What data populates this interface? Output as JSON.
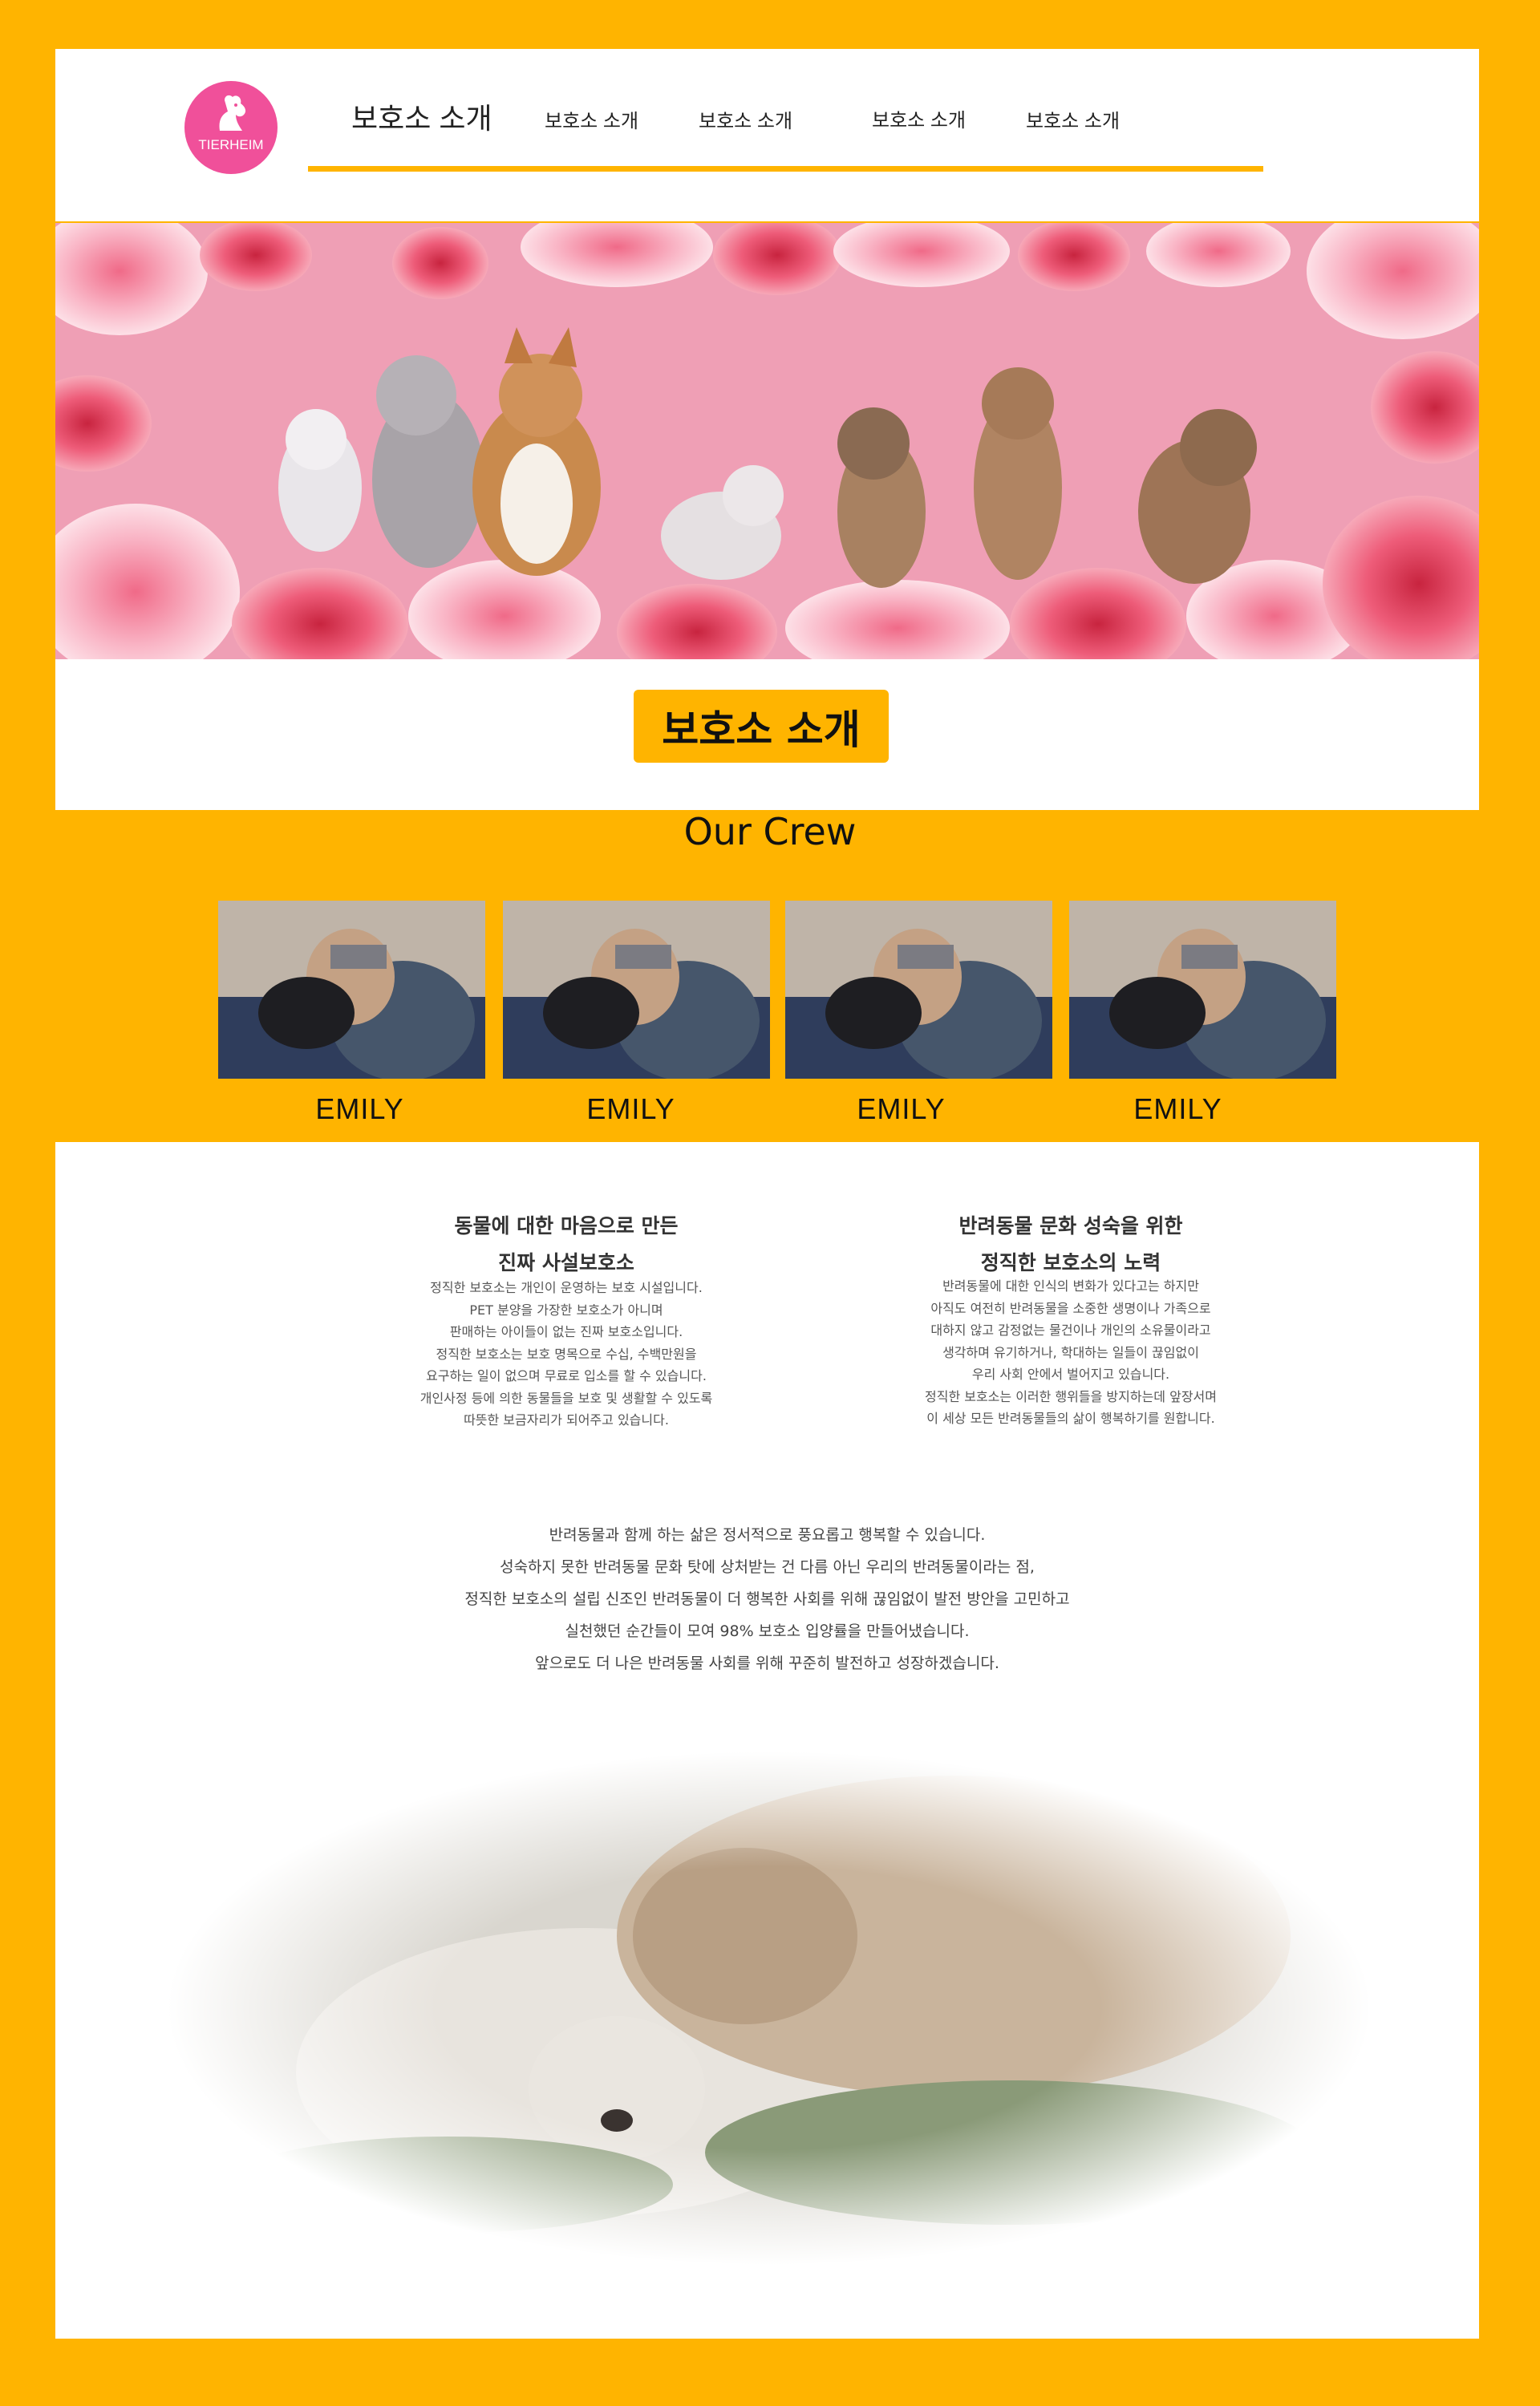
{
  "header": {
    "logo_text": "TIERHEIM",
    "nav": [
      {
        "label": "보호소 소개"
      },
      {
        "label": "보호소 소개"
      },
      {
        "label": "보호소 소개"
      },
      {
        "label": "보호소 소개"
      },
      {
        "label": "보호소 소개"
      }
    ]
  },
  "hero": {
    "title_button": "보호소 소개"
  },
  "crew": {
    "title": "Our Crew",
    "members": [
      {
        "name": "EMILY"
      },
      {
        "name": "EMILY"
      },
      {
        "name": "EMILY"
      },
      {
        "name": "EMILY"
      }
    ]
  },
  "columns": {
    "left": {
      "heading_1": "동물에 대한 마음으로 만든",
      "heading_2": "진짜 사설보호소",
      "lines": [
        "정직한 보호소는 개인이 운영하는 보호 시설입니다.",
        "PET 분양을 가장한 보호소가 아니며",
        "판매하는 아이들이 없는 진짜 보호소입니다.",
        "정직한 보호소는 보호 명목으로 수십, 수백만원을",
        "요구하는 일이 없으며 무료로 입소를 할 수 있습니다.",
        "개인사정 등에 의한 동물들을 보호 및 생활할 수 있도록",
        "따뜻한 보금자리가 되어주고 있습니다."
      ]
    },
    "right": {
      "heading_1": "반려동물 문화 성숙을 위한",
      "heading_2": "정직한 보호소의 노력",
      "lines": [
        "반려동물에 대한 인식의 변화가 있다고는 하지만",
        "아직도 여전히 반려동물을 소중한 생명이나 가족으로",
        "대하지 않고 감정없는 물건이나 개인의 소유물이라고",
        "생각하며 유기하거나, 학대하는 일들이 끊임없이",
        "우리 사회 안에서 벌어지고 있습니다.",
        "정직한 보호소는 이러한 행위들을 방지하는데 앞장서며",
        "이 세상 모든 반려동물들의 삶이 행복하기를 원합니다."
      ]
    }
  },
  "statement": [
    "반려동물과 함께 하는 삶은 정서적으로 풍요롭고 행복할 수 있습니다.",
    "성숙하지 못한 반려동물 문화 탓에 상처받는 건 다름 아닌 우리의 반려동물이라는 점,",
    "정직한 보호소의 설립 신조인 반려동물이 더 행복한 사회를 위해 끊임없이 발전 방안을 고민하고",
    "실천했던 순간들이 모여 98% 보호소 입양률을 만들어냈습니다.",
    "앞으로도 더 나은 반려동물 사회를 위해 꾸준히 발전하고 성장하겠습니다."
  ],
  "colors": {
    "background": "#FFB400",
    "accent": "#FFB400",
    "logo": "#F0509A",
    "banner": "#F2A3B8"
  }
}
